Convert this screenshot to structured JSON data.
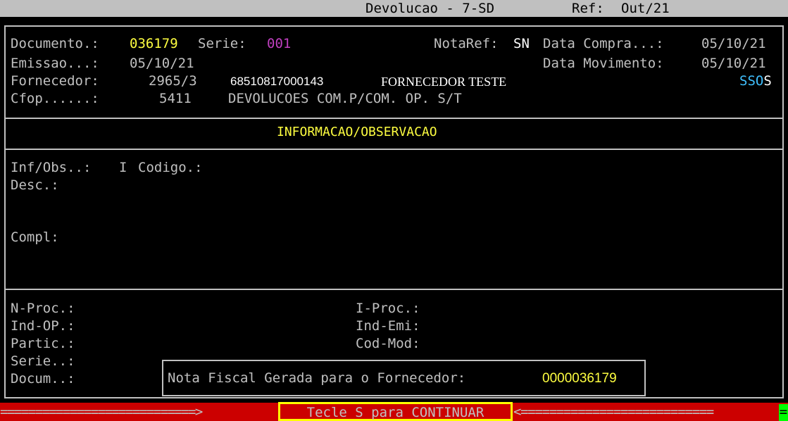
{
  "header": {
    "title": "Devolucao - 7-SD",
    "ref_label": "Ref:",
    "ref_value": "Out/21"
  },
  "document": {
    "documento_label": "Documento.:",
    "documento_value": "036179",
    "serie_label": "Serie:",
    "serie_value": "001",
    "notaref_label": "NotaRef:",
    "notaref_value": "SN",
    "data_compra_label": "Data Compra...:",
    "data_compra_value": "05/10/21",
    "emissao_label": "Emissao...:",
    "emissao_value": "05/10/21",
    "data_movimento_label": "Data Movimento:",
    "data_movimento_value": "05/10/21",
    "fornecedor_label": "Fornecedor:",
    "fornecedor_code": "2965/3",
    "fornecedor_cnpj": "68510817000143",
    "fornecedor_name": "FORNECEDOR TESTE",
    "flags": [
      "S",
      "S",
      "O",
      "S"
    ],
    "cfop_label": "Cfop......:",
    "cfop_value": "5411",
    "cfop_desc": "DEVOLUCOES COM.P/COM. OP. S/T"
  },
  "info_section": {
    "title": "INFORMACAO/OBSERVACAO",
    "infobs_label": "Inf/Obs..:",
    "infobs_value": "I",
    "codigo_label": "Codigo.:",
    "desc_label": "Desc.:",
    "compl_label": "Compl:"
  },
  "process_section": {
    "nproc_label": "N-Proc.:",
    "iproc_label": "I-Proc.:",
    "indop_label": "Ind-OP.:",
    "indemi_label": "Ind-Emi:",
    "partic_label": "Partic.:",
    "codmod_label": "Cod-Mod:",
    "serie_label": "Serie..:",
    "docum_label": "Docum..:"
  },
  "popup": {
    "message": "Nota Fiscal Gerada para o Fornecedor:",
    "number": "0000036179"
  },
  "footer": {
    "left_arrow": "============================>",
    "continue_label": "Tecle S para CONTINUAR",
    "right_arrow": "<==========================="
  },
  "colors": {
    "highlight": "#ffff40",
    "serie": "#c040c0",
    "footer_bg": "#cc0000",
    "cursor": "#00ff00"
  }
}
